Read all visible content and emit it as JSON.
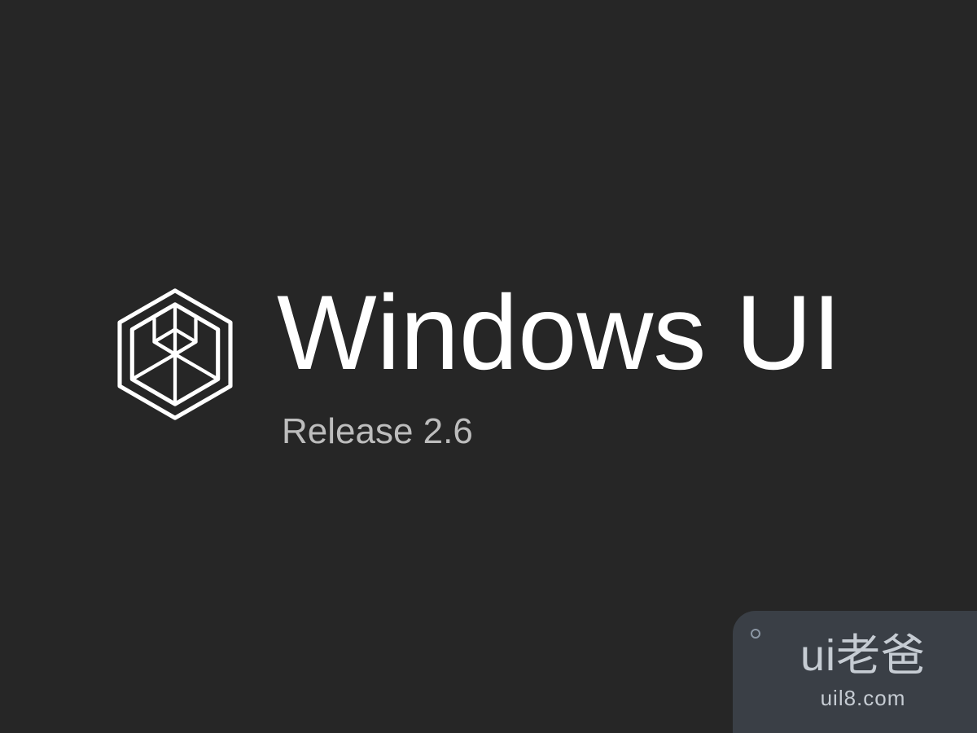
{
  "splash": {
    "title": "Windows UI",
    "subtitle": "Release 2.6",
    "logo_name": "windows-ui-hexagon-icon"
  },
  "watermark": {
    "brand": "ui老爸",
    "url": "uil8.com"
  },
  "colors": {
    "background": "#262626",
    "text_primary": "#ffffff",
    "text_secondary": "#bdbdbd",
    "watermark_bg": "#3a3f46",
    "watermark_text": "#c6ccd3"
  }
}
